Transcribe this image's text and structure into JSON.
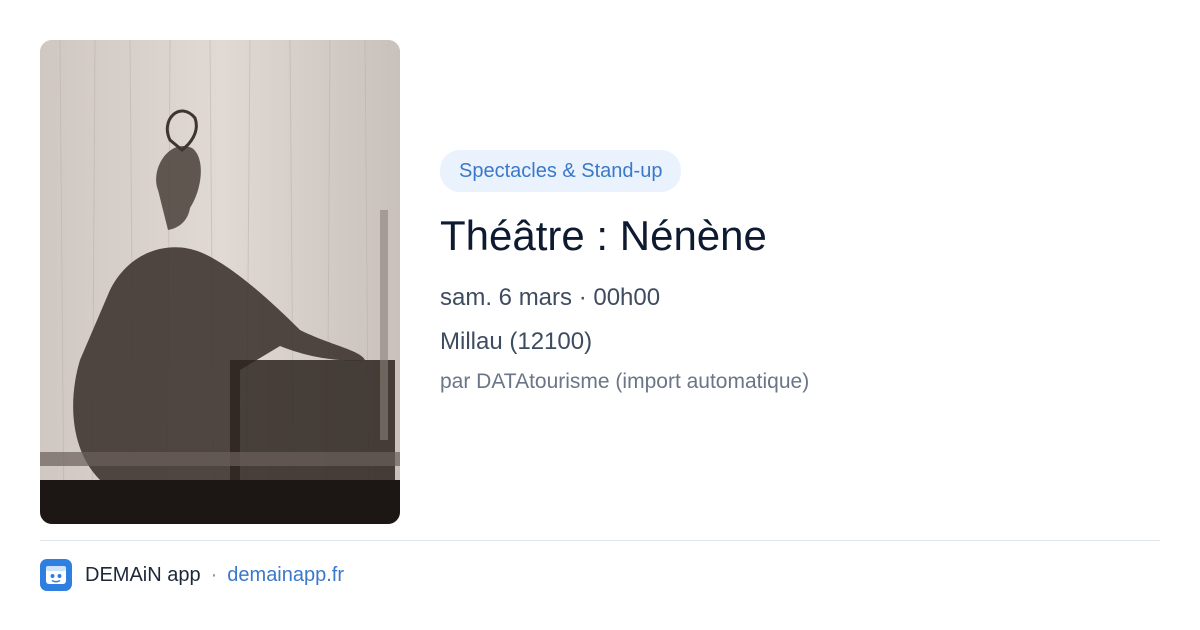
{
  "event": {
    "category": "Spectacles & Stand-up",
    "title": "Théâtre : Nénène",
    "datetime": "sam. 6 mars · 00h00",
    "location": "Millau (12100)",
    "source": "par DATAtourisme (import automatique)"
  },
  "footer": {
    "app_name": "DEMAiN app",
    "separator": "·",
    "domain": "demainapp.fr"
  },
  "colors": {
    "accent": "#3a78c9",
    "badge_bg": "#eaf2fd",
    "logo_bg": "#2f7fe0"
  }
}
